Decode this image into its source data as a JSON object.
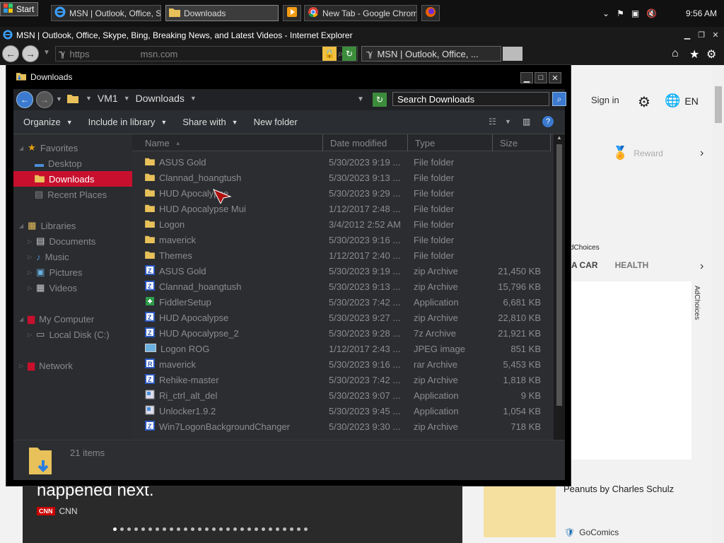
{
  "taskbar": {
    "start_label": "Start",
    "buttons": [
      {
        "label": "MSN | Outlook, Office, Sk...",
        "icon": "ie-icon"
      },
      {
        "label": "Downloads",
        "icon": "folder-icon"
      },
      {
        "label": "",
        "icon": "media-player-icon"
      },
      {
        "label": "New Tab - Google Chrome",
        "icon": "chrome-icon"
      },
      {
        "label": "",
        "icon": "firefox-icon"
      }
    ],
    "clock": "9:56 AM"
  },
  "ie": {
    "window_title": "MSN | Outlook, Office, Skype, Bing, Breaking News, and Latest Videos - Internet Explorer",
    "address_scheme": "https",
    "address_domain": "msn.com",
    "tab_title": "MSN | Outlook, Office, ..."
  },
  "msn": {
    "sign_in": "Sign in",
    "language": "EN",
    "rewards": "Reward",
    "adchoices_small": "dChoices",
    "categories": [
      "A CAR",
      "HEALTH"
    ],
    "ad_vertical": "AdChoices",
    "hero_text": "happened next.",
    "hero_source": "CNN",
    "comic_title": "Peanuts by Charles Schulz",
    "comic_source": "GoComics"
  },
  "explorer": {
    "title": "Downloads",
    "breadcrumb": [
      "VM1",
      "Downloads"
    ],
    "search_placeholder": "Search Downloads",
    "toolbar": {
      "organize": "Organize",
      "include": "Include in library",
      "share": "Share with",
      "new_folder": "New folder"
    },
    "nav": {
      "favorites": "Favorites",
      "desktop": "Desktop",
      "downloads": "Downloads",
      "recent": "Recent Places",
      "libraries": "Libraries",
      "documents": "Documents",
      "music": "Music",
      "pictures": "Pictures",
      "videos": "Videos",
      "computer": "My Computer",
      "local_disk": "Local Disk (C:)",
      "network": "Network"
    },
    "columns": {
      "name": "Name",
      "date": "Date modified",
      "type": "Type",
      "size": "Size"
    },
    "files": [
      {
        "name": "ASUS Gold",
        "date": "5/30/2023 9:19 ...",
        "type": "File folder",
        "size": "",
        "icon": "folder-icon"
      },
      {
        "name": "Clannad_hoangtush",
        "date": "5/30/2023 9:13 ...",
        "type": "File folder",
        "size": "",
        "icon": "folder-icon"
      },
      {
        "name": "HUD Apocalypse",
        "date": "5/30/2023 9:29 ...",
        "type": "File folder",
        "size": "",
        "icon": "folder-icon"
      },
      {
        "name": "HUD Apocalypse Mui",
        "date": "1/12/2017 2:48 ...",
        "type": "File folder",
        "size": "",
        "icon": "folder-icon"
      },
      {
        "name": "Logon",
        "date": "3/4/2012 2:52 AM",
        "type": "File folder",
        "size": "",
        "icon": "folder-icon"
      },
      {
        "name": "maverick",
        "date": "5/30/2023 9:16 ...",
        "type": "File folder",
        "size": "",
        "icon": "folder-icon"
      },
      {
        "name": "Themes",
        "date": "1/12/2017 2:40 ...",
        "type": "File folder",
        "size": "",
        "icon": "folder-icon"
      },
      {
        "name": "ASUS Gold",
        "date": "5/30/2023 9:19 ...",
        "type": "zip Archive",
        "size": "21,450 KB",
        "icon": "zip-icon"
      },
      {
        "name": "Clannad_hoangtush",
        "date": "5/30/2023 9:13 ...",
        "type": "zip Archive",
        "size": "15,796 KB",
        "icon": "zip-icon"
      },
      {
        "name": "FiddlerSetup",
        "date": "5/30/2023 7:42 ...",
        "type": "Application",
        "size": "6,681 KB",
        "icon": "installer-icon"
      },
      {
        "name": "HUD Apocalypse",
        "date": "5/30/2023 9:27 ...",
        "type": "zip Archive",
        "size": "22,810 KB",
        "icon": "zip-icon"
      },
      {
        "name": "HUD Apocalypse_2",
        "date": "5/30/2023 9:28 ...",
        "type": "7z Archive",
        "size": "21,921 KB",
        "icon": "zip-icon"
      },
      {
        "name": "Logon ROG",
        "date": "1/12/2017 2:43 ...",
        "type": "JPEG image",
        "size": "851 KB",
        "icon": "image-icon"
      },
      {
        "name": "maverick",
        "date": "5/30/2023 9:16 ...",
        "type": "rar Archive",
        "size": "5,453 KB",
        "icon": "rar-icon"
      },
      {
        "name": "Rehike-master",
        "date": "5/30/2023 7:42 ...",
        "type": "zip Archive",
        "size": "1,818 KB",
        "icon": "zip-icon"
      },
      {
        "name": "Ri_ctrl_alt_del",
        "date": "5/30/2023 9:07 ...",
        "type": "Application",
        "size": "9 KB",
        "icon": "app-icon"
      },
      {
        "name": "Unlocker1.9.2",
        "date": "5/30/2023 9:45 ...",
        "type": "Application",
        "size": "1,054 KB",
        "icon": "app-icon"
      },
      {
        "name": "Win7LogonBackgroundChanger",
        "date": "5/30/2023 9:30 ...",
        "type": "zip Archive",
        "size": "718 KB",
        "icon": "zip-icon"
      }
    ],
    "item_count": "21 items"
  }
}
